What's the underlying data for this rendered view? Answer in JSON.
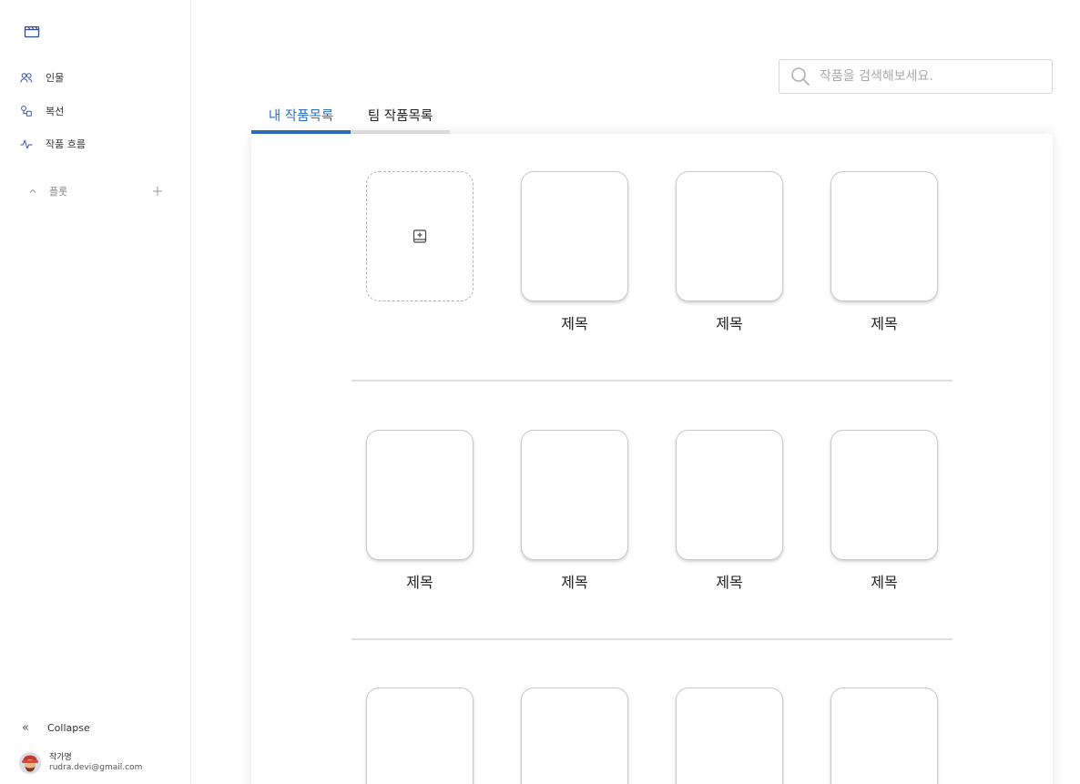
{
  "sidebar": {
    "nav": [
      {
        "label": "인물",
        "icon": "people-icon"
      },
      {
        "label": "복선",
        "icon": "foreshadow-icon"
      },
      {
        "label": "작품 흐름",
        "icon": "activity-icon"
      }
    ],
    "plot_label": "플롯",
    "collapse_label": "Collapse",
    "user": {
      "name": "작가명",
      "email": "rudra.devi@gmail.com"
    }
  },
  "search": {
    "placeholder": "작품을 검색해보세요."
  },
  "tabs": [
    {
      "label": "내 작품목록",
      "active": true
    },
    {
      "label": "팀 작품목록",
      "active": false
    }
  ],
  "works": {
    "row1": [
      "제목",
      "제목",
      "제목"
    ],
    "row2": [
      "제목",
      "제목",
      "제목",
      "제목"
    ],
    "row3_count": 4
  },
  "colors": {
    "accent": "#2f6fc1",
    "divider": "#dedede"
  }
}
